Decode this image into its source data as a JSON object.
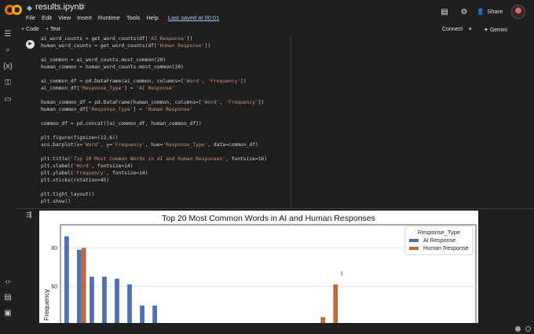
{
  "header": {
    "title": "results.ipynb",
    "star_icon": "☆",
    "menu": [
      "File",
      "Edit",
      "View",
      "Insert",
      "Runtime",
      "Tools",
      "Help"
    ],
    "saved": "Last saved at 00:01",
    "share_label": "Share"
  },
  "toolbar": {
    "add_code": "+ Code",
    "add_text": "+ Text",
    "connect": "Connect",
    "gemini": "Gemini"
  },
  "code_lines": [
    "ai_word_counts = get_word_counts(df['AI_Response'])",
    "human_word_counts = get_word_counts(df['Human_Response'])",
    "",
    "ai_common = ai_word_counts.most_common(20)",
    "human_common = human_word_counts.most_common(20)",
    "",
    "ai_common_df = pd.DataFrame(ai_common, columns=['Word', 'Frequency'])",
    "ai_common_df['Response_Type'] = 'AI Response'",
    "",
    "human_common_df = pd.DataFrame(human_common, columns=['Word', 'Frequency'])",
    "human_common_df['Response_Type'] = 'Human Response'",
    "",
    "common_df = pd.concat([ai_common_df, human_common_df])",
    "",
    "plt.figure(figsize=(12,6))",
    "sns.barplot(x='Word', y='Frequency', hue='Response_Type', data=common_df)",
    "",
    "plt.title('Top 20 Most Common Words in AI and Human Responses', fontsize=16)",
    "plt.xlabel('Word', fontsize=14)",
    "plt.ylabel('Frequency', fontsize=14)",
    "plt.xticks(rotation=45)",
    "",
    "plt.tight_layout()",
    "plt.show()"
  ],
  "colors": {
    "ai": "#4c72b0",
    "human": "#c0693f"
  },
  "chart_data": {
    "type": "bar",
    "title": "Top 20 Most Common Words in AI and Human Responses",
    "ylabel": "Frequency",
    "legend_title": "Response_Type",
    "legend_position": "top-right",
    "grid": true,
    "yticks": [
      40,
      60,
      80
    ],
    "ylim": [
      34,
      92
    ],
    "num_slots": 33,
    "series": [
      {
        "name": "AI Response",
        "slots": [
          0,
          1,
          2,
          3,
          4,
          5,
          6,
          7,
          8,
          9
        ],
        "values": [
          86,
          79,
          65,
          65,
          64,
          61,
          50,
          50,
          40,
          39
        ]
      },
      {
        "name": "Human Response",
        "slots": [
          1,
          6,
          20,
          21,
          22
        ],
        "values": [
          80,
          40,
          44,
          61,
          41
        ]
      }
    ]
  }
}
